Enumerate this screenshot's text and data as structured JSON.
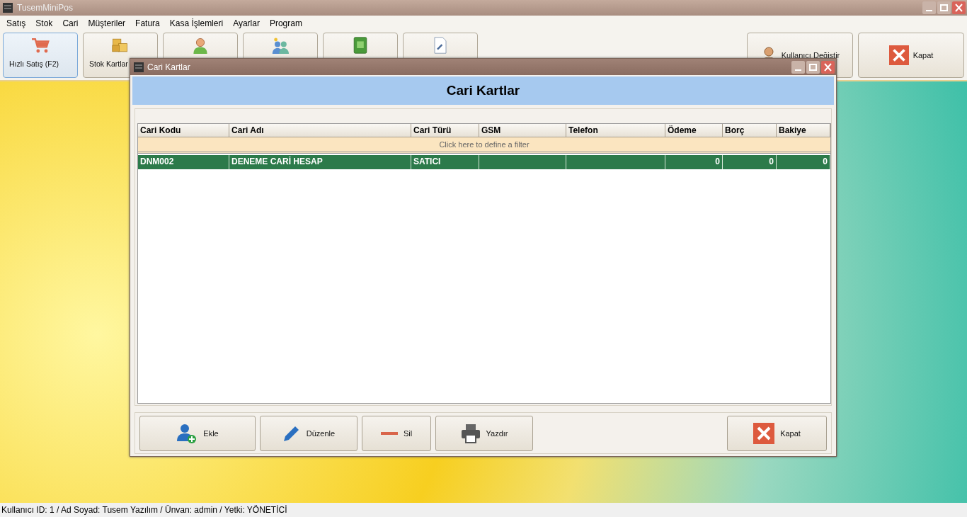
{
  "window": {
    "title": "TusemMiniPos"
  },
  "menu": [
    "Satış",
    "Stok",
    "Cari",
    "Müşteriler",
    "Fatura",
    "Kasa İşlemleri",
    "Ayarlar",
    "Program"
  ],
  "toolbar": {
    "buttons": [
      {
        "label": "Hızlı Satış (F2)",
        "selected": true
      },
      {
        "label": "Stok Kartlar",
        "selected": false
      },
      {
        "selected": false
      },
      {
        "selected": false
      },
      {
        "selected": false
      },
      {
        "selected": false
      }
    ],
    "right_buttons": [
      {
        "label": "Kullanıcı Değiştir"
      },
      {
        "label": "Kapat"
      }
    ]
  },
  "dialog": {
    "title": "Cari Kartlar",
    "header": "Cari Kartlar",
    "table": {
      "columns": [
        "Cari Kodu",
        "Cari Adı",
        "Cari Türü",
        "GSM",
        "Telefon",
        "Ödeme",
        "Borç",
        "Bakiye"
      ],
      "filter_hint": "Click here to define a filter",
      "rows": [
        {
          "cells": [
            "DNM002",
            "DENEME CARİ HESAP",
            "SATICI",
            "",
            "",
            "0",
            "0",
            "0"
          ],
          "selected": true
        }
      ]
    },
    "buttons": [
      {
        "label": "Ekle"
      },
      {
        "label": "Düzenle"
      },
      {
        "label": "Sil"
      },
      {
        "label": "Yazdır"
      },
      {
        "label": "Kapat"
      }
    ]
  },
  "status_bar": "Kullanıcı ID: 1 / Ad Soyad: Tusem Yazılım / Ünvan: admin / Yetki: YÖNETİCİ"
}
